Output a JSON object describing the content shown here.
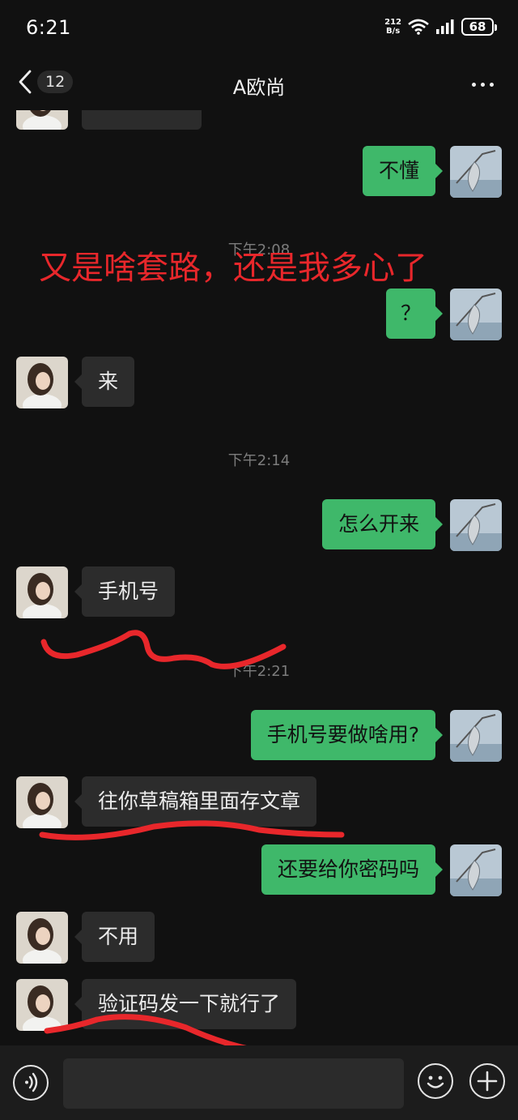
{
  "status_bar": {
    "time": "6:21",
    "net_speed_value": "212",
    "net_speed_unit": "B/s",
    "battery": "68",
    "icons": [
      "wifi-icon",
      "signal-icon",
      "battery-icon"
    ]
  },
  "nav": {
    "back_count": "12",
    "title": "A欧尚",
    "more_icon": "more-icon"
  },
  "overlay_annotation": "又是啥套路，还是我多心了",
  "messages": [
    {
      "side": "right",
      "text": "不懂"
    },
    {
      "type": "time",
      "text": "下午2:08"
    },
    {
      "side": "right",
      "text": "？"
    },
    {
      "side": "left",
      "text": "来"
    },
    {
      "type": "time",
      "text": "下午2:14"
    },
    {
      "side": "right",
      "text": "怎么开来"
    },
    {
      "side": "left",
      "text": "手机号"
    },
    {
      "type": "time",
      "text": "下午2:21"
    },
    {
      "side": "right",
      "text": "手机号要做啥用?"
    },
    {
      "side": "left",
      "text": "往你草稿箱里面存文章"
    },
    {
      "side": "right",
      "text": "还要给你密码吗"
    },
    {
      "side": "left",
      "text": "不用"
    },
    {
      "side": "left",
      "text": "验证码发一下就行了"
    }
  ],
  "input": {
    "placeholder": "",
    "voice_icon": "voice-icon",
    "emoji_icon": "emoji-icon",
    "plus_icon": "plus-icon"
  },
  "colors": {
    "background": "#111111",
    "bubble_self": "#3fb86a",
    "bubble_other": "#2c2c2c",
    "annotation_red": "#e8272b"
  }
}
